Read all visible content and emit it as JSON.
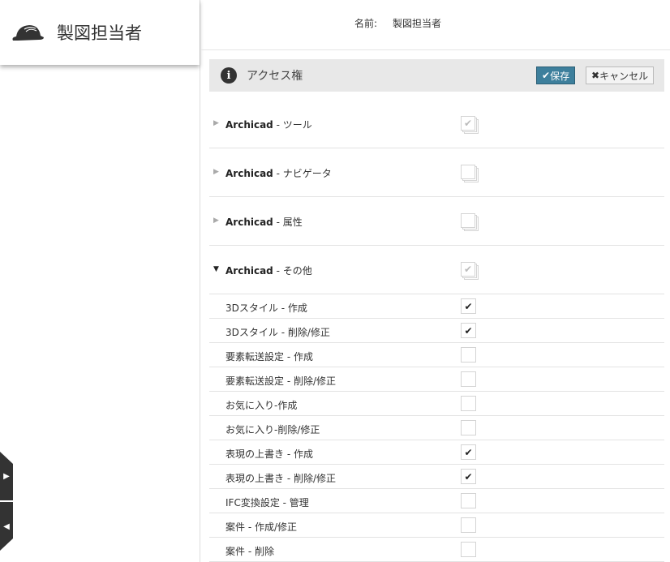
{
  "role": {
    "title": "製図担当者"
  },
  "name_field": {
    "label": "名前:",
    "value": "製図担当者"
  },
  "section": {
    "title": "アクセス権",
    "save_label": "保存",
    "cancel_label": "キャンセル"
  },
  "groups": [
    {
      "prefix": "Archicad",
      "suffix": " - ツール",
      "expanded": false,
      "state": "partial"
    },
    {
      "prefix": "Archicad",
      "suffix": " - ナビゲータ",
      "expanded": false,
      "state": "none"
    },
    {
      "prefix": "Archicad",
      "suffix": " - 属性",
      "expanded": false,
      "state": "none"
    },
    {
      "prefix": "Archicad",
      "suffix": " - その他",
      "expanded": true,
      "state": "partial"
    }
  ],
  "items": [
    {
      "label": "3Dスタイル - 作成",
      "checked": true
    },
    {
      "label": "3Dスタイル - 削除/修正",
      "checked": true
    },
    {
      "label": "要素転送設定 - 作成",
      "checked": false
    },
    {
      "label": "要素転送設定 - 削除/修正",
      "checked": false
    },
    {
      "label": "お気に入り-作成",
      "checked": false
    },
    {
      "label": "お気に入り-削除/修正",
      "checked": false
    },
    {
      "label": "表現の上書き - 作成",
      "checked": true
    },
    {
      "label": "表現の上書き - 削除/修正",
      "checked": true
    },
    {
      "label": "IFC変換設定 - 管理",
      "checked": false
    },
    {
      "label": "案件 - 作成/修正",
      "checked": false
    },
    {
      "label": "案件 - 削除",
      "checked": false
    }
  ]
}
